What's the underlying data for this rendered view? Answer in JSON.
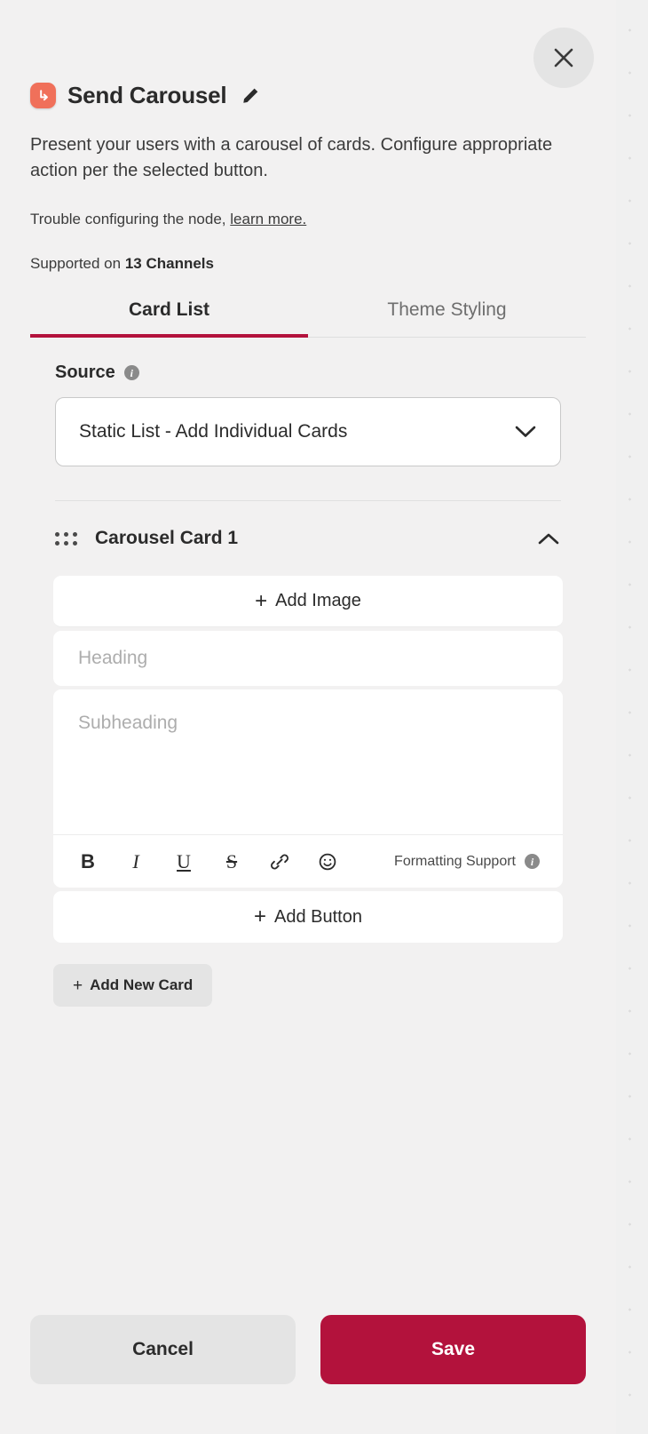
{
  "panel": {
    "node_icon": "send-node-icon",
    "title": "Send Carousel",
    "edit_icon": "pencil-icon",
    "close_icon": "close-icon",
    "description": "Present your users with a carousel of cards. Configure appropriate action per the selected button.",
    "trouble_text": "Trouble configuring the node,",
    "trouble_link": "learn more.",
    "supported_prefix": "Supported on",
    "supported_count": "13 Channels"
  },
  "tabs": [
    {
      "label": "Card List",
      "active": true
    },
    {
      "label": "Theme Styling",
      "active": false
    }
  ],
  "source": {
    "label": "Source",
    "info_icon": "info-icon",
    "selected": "Static List - Add Individual Cards",
    "chevron_icon": "chevron-down-icon"
  },
  "card": {
    "drag_icon": "drag-handle-icon",
    "title": "Carousel Card 1",
    "collapse_icon": "chevron-up-icon",
    "add_image_label": "Add Image",
    "heading_placeholder": "Heading",
    "heading_value": "",
    "subheading_placeholder": "Subheading",
    "subheading_value": "",
    "add_button_label": "Add Button",
    "plus": "+"
  },
  "toolbar": {
    "bold": "B",
    "italic": "I",
    "underline": "U",
    "strikethrough": "S",
    "link_icon": "link-icon",
    "emoji_icon": "emoji-icon",
    "formatting_support_label": "Formatting Support",
    "formatting_info_icon": "info-icon",
    "info_glyph": "i"
  },
  "add_new_card": {
    "label": "Add New Card",
    "plus": "+"
  },
  "footer": {
    "cancel_label": "Cancel",
    "save_label": "Save"
  },
  "colors": {
    "accent": "#b3123c",
    "node_icon_bg": "#f0705a",
    "panel_bg": "#f2f1f1",
    "field_bg": "#ffffff",
    "muted_btn_bg": "#e4e4e4"
  }
}
